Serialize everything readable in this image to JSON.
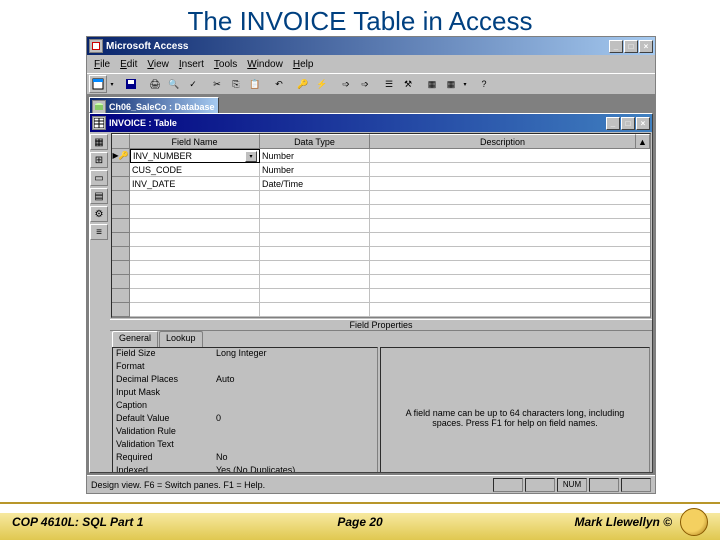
{
  "slide": {
    "title": "The INVOICE Table in Access"
  },
  "app": {
    "title": "Microsoft Access",
    "menus": [
      "File",
      "Edit",
      "View",
      "Insert",
      "Tools",
      "Window",
      "Help"
    ]
  },
  "db_window": {
    "title": "Ch06_SaleCo : Database"
  },
  "design": {
    "title": "INVOICE : Table",
    "columns": {
      "field": "Field Name",
      "type": "Data Type",
      "desc": "Description"
    },
    "rows": [
      {
        "pk": true,
        "field": "INV_NUMBER",
        "type": "Number",
        "desc": ""
      },
      {
        "pk": false,
        "field": "CUS_CODE",
        "type": "Number",
        "desc": ""
      },
      {
        "pk": false,
        "field": "INV_DATE",
        "type": "Date/Time",
        "desc": ""
      }
    ],
    "props_label": "Field Properties",
    "tabs": [
      "General",
      "Lookup"
    ],
    "properties": [
      {
        "name": "Field Size",
        "value": "Long Integer"
      },
      {
        "name": "Format",
        "value": ""
      },
      {
        "name": "Decimal Places",
        "value": "Auto"
      },
      {
        "name": "Input Mask",
        "value": ""
      },
      {
        "name": "Caption",
        "value": ""
      },
      {
        "name": "Default Value",
        "value": "0"
      },
      {
        "name": "Validation Rule",
        "value": ""
      },
      {
        "name": "Validation Text",
        "value": ""
      },
      {
        "name": "Required",
        "value": "No"
      },
      {
        "name": "Indexed",
        "value": "Yes (No Duplicates)"
      }
    ],
    "hint": "A field name can be up to 64 characters long, including spaces. Press F1 for help on field names."
  },
  "statusbar": {
    "text": "Design view.  F6 = Switch panes.  F1 = Help.",
    "num": "NUM"
  },
  "footer": {
    "left": "COP 4610L: SQL Part 1",
    "mid": "Page 20",
    "right": "Mark Llewellyn ©"
  }
}
